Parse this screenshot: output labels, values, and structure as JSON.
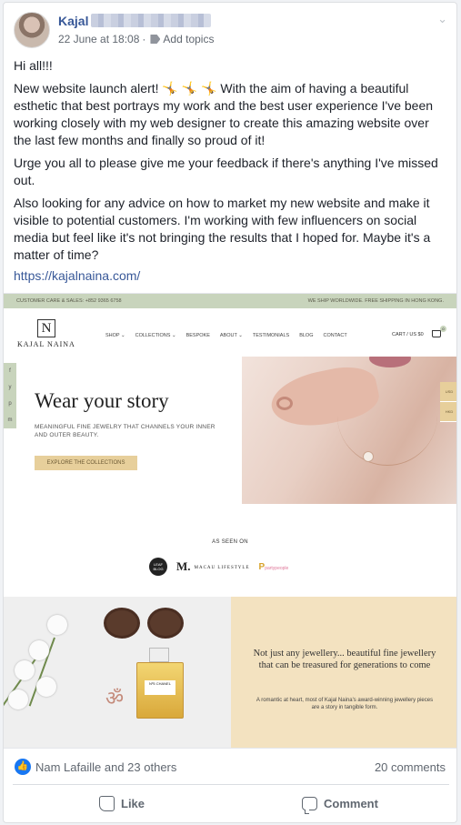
{
  "post": {
    "author": "Kajal",
    "timestamp": "22 June at 18:08",
    "add_topics": "Add topics",
    "paragraphs": [
      "Hi all!!!",
      "New website launch alert! 🤸 🤸 🤸 With the aim of having a beautiful esthetic that best portrays my work and the best user experience I've been working closely with my web designer to create this amazing website over the last few months and finally so proud of it!",
      "Urge you all to please give me your feedback if there's anything I've missed out.",
      "Also looking for any advice on how to market my new website and make it visible to potential customers. I'm working with few influencers on social media but feel like it's not bringing the results that I hoped for. Maybe it's a matter of time?"
    ],
    "link": "https://kajalnaina.com/"
  },
  "preview": {
    "top_left": "CUSTOMER CARE & SALES: +852 9365 6758",
    "top_right": "WE SHIP WORLDWIDE. FREE SHIPPING IN HONG KONG.",
    "logo_mark": "N",
    "logo_text": "KAJAL NAINA",
    "nav": [
      "SHOP ⌄",
      "COLLECTIONS ⌄",
      "BESPOKE",
      "ABOUT ⌄",
      "TESTIMONIALS",
      "BLOG",
      "CONTACT"
    ],
    "cart": "CART / US $0",
    "cart_count": "0",
    "social": [
      "f",
      "y",
      "p",
      "m"
    ],
    "hero_title": "Wear your story",
    "hero_subtitle": "MEANINGFUL FINE JEWELRY THAT CHANNELS YOUR INNER AND OUTER BEAUTY.",
    "hero_button": "EXPLORE THE COLLECTIONS",
    "currency_1": "USD",
    "currency_2": "HKD",
    "seen_on": "AS SEEN ON",
    "press_1": "LEAF BLOG",
    "press_2_mark": "M.",
    "press_2_text": "MACAU LIFESTYLE",
    "press_3_mark": "P",
    "press_3_text": "partypeople",
    "perfume_label": "Nº5 CHANEL",
    "promo_title": "Not just any jewellery... beautiful fine jewellery that can be treasured for generations to come",
    "promo_subtitle": "A romantic at heart, most of Kajal Naina's award-winning jewellery pieces are a story in tangible form."
  },
  "footer": {
    "reactions": "Nam Lafaille and 23 others",
    "comments": "20 comments",
    "like_label": "Like",
    "comment_label": "Comment"
  }
}
